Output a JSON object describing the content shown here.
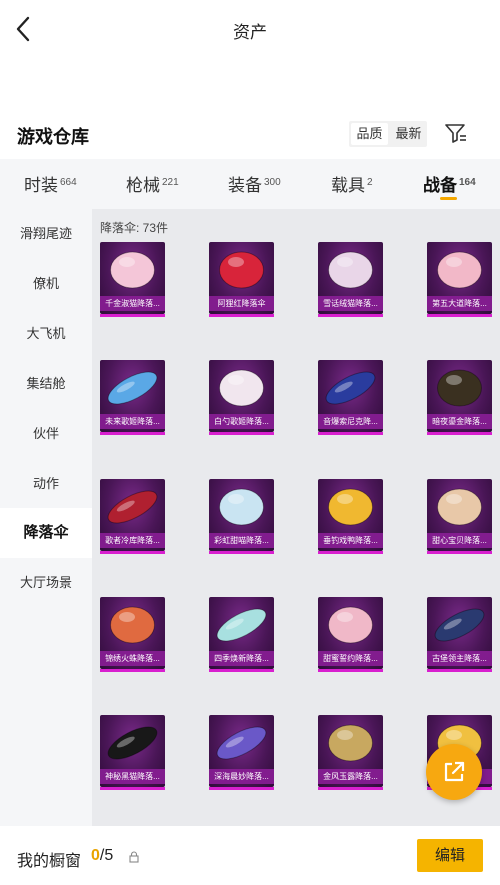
{
  "header": {
    "title": "资产"
  },
  "warehouse": {
    "title": "游戏仓库",
    "sort_options": [
      "品质",
      "最新"
    ]
  },
  "categories": [
    {
      "label": "时装",
      "count": "664"
    },
    {
      "label": "枪械",
      "count": "221"
    },
    {
      "label": "装备",
      "count": "300"
    },
    {
      "label": "载具",
      "count": "2"
    },
    {
      "label": "战备",
      "count": "164"
    }
  ],
  "sidebar": {
    "items": [
      "滑翔尾迹",
      "僚机",
      "大飞机",
      "集结舱",
      "伙伴",
      "动作",
      "降落伞",
      "大厅场景"
    ],
    "active": "降落伞"
  },
  "content": {
    "count_label": "降落伞: 73件",
    "items": [
      {
        "name": "千金淑猫降落...",
        "color": "#f4c6d8"
      },
      {
        "name": "阿狸红降落伞",
        "color": "#d8243a"
      },
      {
        "name": "雪话绒猫降落...",
        "color": "#e9d6e8"
      },
      {
        "name": "第五大道降落...",
        "color": "#f2b8c8"
      },
      {
        "name": "未来歌姬降落...",
        "color": "#5aa8e6"
      },
      {
        "name": "白勺歌姬降落...",
        "color": "#f1e6ee"
      },
      {
        "name": "音爆索尼克降...",
        "color": "#2a3c9e"
      },
      {
        "name": "暗夜鎏金降落...",
        "color": "#3a3020"
      },
      {
        "name": "歌者冷库降落...",
        "color": "#b02030"
      },
      {
        "name": "彩虹甜喵降落...",
        "color": "#c9e4f2"
      },
      {
        "name": "垂钓戏鸭降落...",
        "color": "#f0b830"
      },
      {
        "name": "甜心宝贝降落...",
        "color": "#e8c8a8"
      },
      {
        "name": "锦绣火蛛降落...",
        "color": "#e06a40"
      },
      {
        "name": "四季焕新降落...",
        "color": "#a8e0e0"
      },
      {
        "name": "甜蜜誓约降落...",
        "color": "#f0b8c8"
      },
      {
        "name": "古堡领主降落...",
        "color": "#2a3a70"
      },
      {
        "name": "神秘黑猫降落...",
        "color": "#181818"
      },
      {
        "name": "深海晨妙降落...",
        "color": "#6a58c8"
      },
      {
        "name": "金风玉露降落...",
        "color": "#c8a860"
      },
      {
        "name": "",
        "color": "#f0c040"
      }
    ]
  },
  "bottom": {
    "showcase_label": "我的橱窗",
    "current": "0",
    "total": "/5",
    "edit_label": "编辑"
  }
}
